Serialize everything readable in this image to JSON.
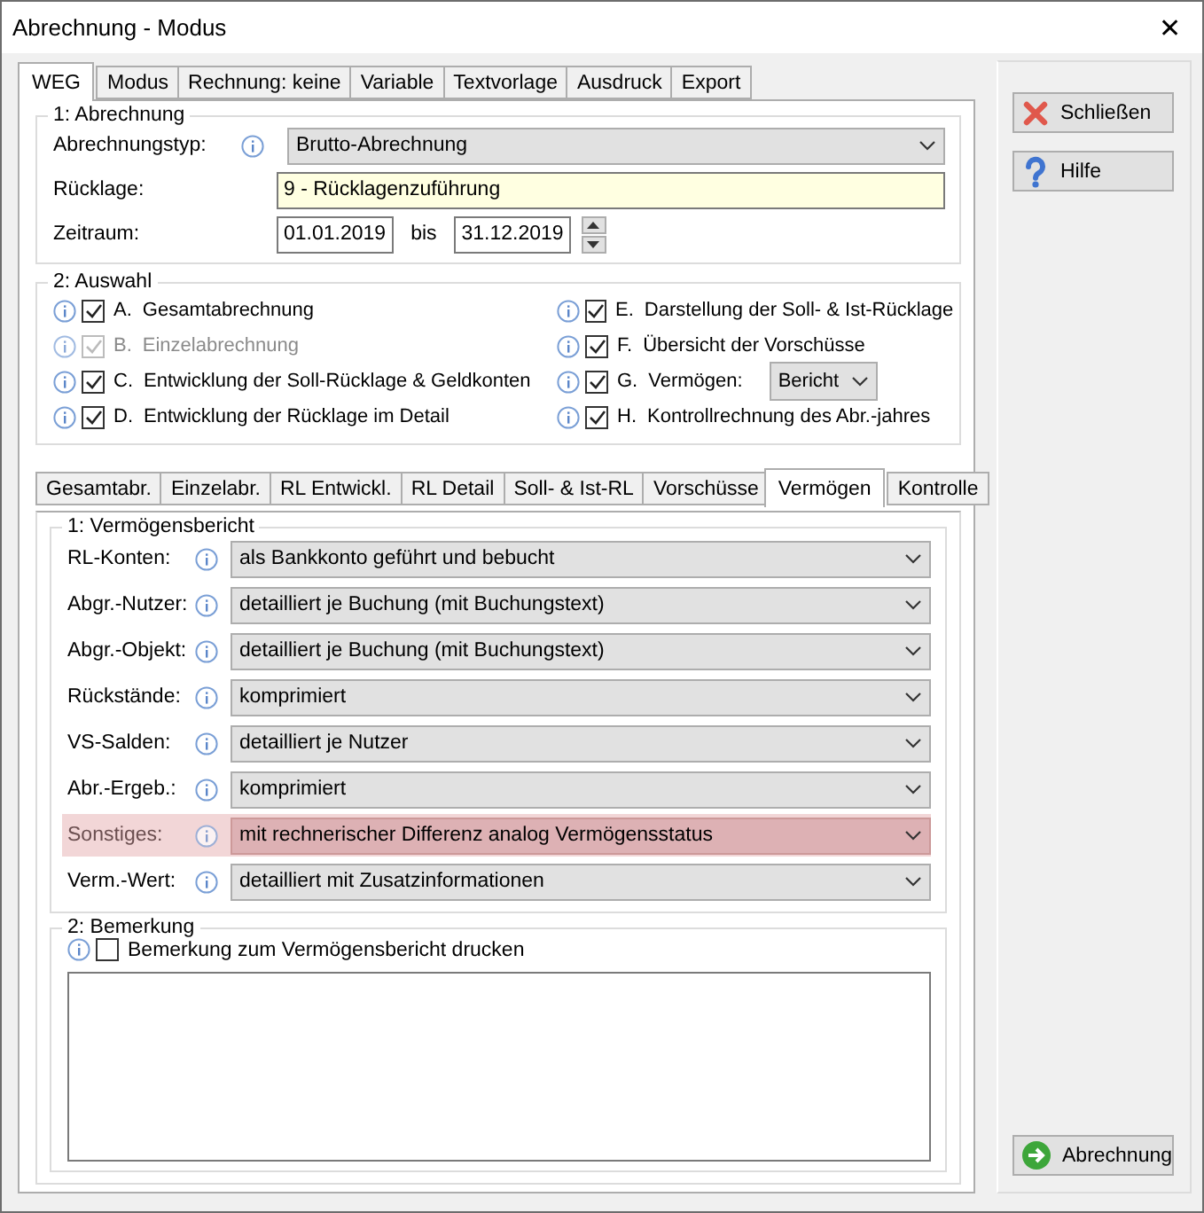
{
  "window": {
    "title": "Abrechnung - Modus",
    "close": "✕"
  },
  "tabs": [
    {
      "label": "WEG",
      "selected": true
    },
    {
      "label": "Modus",
      "selected": false
    },
    {
      "label": "Rechnung: keine",
      "selected": false
    },
    {
      "label": "Variable",
      "selected": false
    },
    {
      "label": "Textvorlage",
      "selected": false
    },
    {
      "label": "Ausdruck",
      "selected": false
    },
    {
      "label": "Export",
      "selected": false
    }
  ],
  "abrechnung": {
    "title": "1: Abrechnung",
    "typ_label": "Abrechnungstyp:",
    "typ_value": "Brutto-Abrechnung",
    "ruecklage_label": "Rücklage:",
    "ruecklage_value": "9 - Rücklagenzuführung",
    "zeitraum_label": "Zeitraum:",
    "from": "01.01.2019",
    "bis": "bis",
    "to": "31.12.2019"
  },
  "auswahl": {
    "title": "2: Auswahl",
    "items": [
      {
        "kind": "checkbox",
        "letter": "A.",
        "label": "Gesamtabrechnung",
        "checked": true,
        "disabled": false
      },
      {
        "kind": "checkbox",
        "letter": "B.",
        "label": "Einzelabrechnung",
        "checked": true,
        "disabled": true
      },
      {
        "kind": "checkbox",
        "letter": "C.",
        "label": "Entwicklung der Soll-Rücklage & Geldkonten",
        "checked": true,
        "disabled": false
      },
      {
        "kind": "checkbox",
        "letter": "D.",
        "label": "Entwicklung der Rücklage im Detail",
        "checked": true,
        "disabled": false
      },
      {
        "kind": "checkbox",
        "letter": "E.",
        "label": "Darstellung der Soll- & Ist-Rücklage",
        "checked": true,
        "disabled": false
      },
      {
        "kind": "checkbox",
        "letter": "F.",
        "label": "Übersicht der Vorschüsse",
        "checked": true,
        "disabled": false
      },
      {
        "kind": "checkbox_select",
        "letter": "G.",
        "label": "Vermögen:",
        "checked": true,
        "disabled": false,
        "value": "Bericht"
      },
      {
        "kind": "checkbox",
        "letter": "H.",
        "label": "Kontrollrechnung des Abr.-jahres",
        "checked": true,
        "disabled": false
      }
    ]
  },
  "subtabs": [
    {
      "label": "Gesamtabr.",
      "selected": false
    },
    {
      "label": "Einzelabr.",
      "selected": false
    },
    {
      "label": "RL Entwickl.",
      "selected": false
    },
    {
      "label": "RL Detail",
      "selected": false
    },
    {
      "label": "Soll- & Ist-RL",
      "selected": false
    },
    {
      "label": "Vorschüsse",
      "selected": false
    },
    {
      "label": "Vermögen",
      "selected": true
    },
    {
      "label": "Kontrolle",
      "selected": false
    }
  ],
  "vermoegensbericht": {
    "title": "1: Vermögensbericht",
    "rows": [
      {
        "label": "RL-Konten:",
        "value": "als Bankkonto geführt und bebucht",
        "highlighted": false
      },
      {
        "label": "Abgr.-Nutzer:",
        "value": "detailliert je Buchung (mit Buchungstext)",
        "highlighted": false
      },
      {
        "label": "Abgr.-Objekt:",
        "value": "detailliert je Buchung (mit Buchungstext)",
        "highlighted": false
      },
      {
        "label": "Rückstände:",
        "value": "komprimiert",
        "highlighted": false
      },
      {
        "label": "VS-Salden:",
        "value": "detailliert je Nutzer",
        "highlighted": false
      },
      {
        "label": "Abr.-Ergeb.:",
        "value": "komprimiert",
        "highlighted": false
      },
      {
        "label": "Sonstiges:",
        "value": "mit rechnerischer Differenz analog Vermögensstatus",
        "highlighted": true
      },
      {
        "label": "Verm.-Wert:",
        "value": "detailliert mit Zusatzinformationen",
        "highlighted": false
      }
    ]
  },
  "bemerkung": {
    "title": "2: Bemerkung",
    "checkbox_label": "Bemerkung zum Vermögensbericht drucken",
    "checked": false
  },
  "buttons": [
    {
      "kind": "close",
      "label": "Schließen"
    },
    {
      "kind": "help",
      "label": "Hilfe"
    }
  ],
  "action_button": {
    "kind": "go",
    "label": "Abrechnung"
  }
}
